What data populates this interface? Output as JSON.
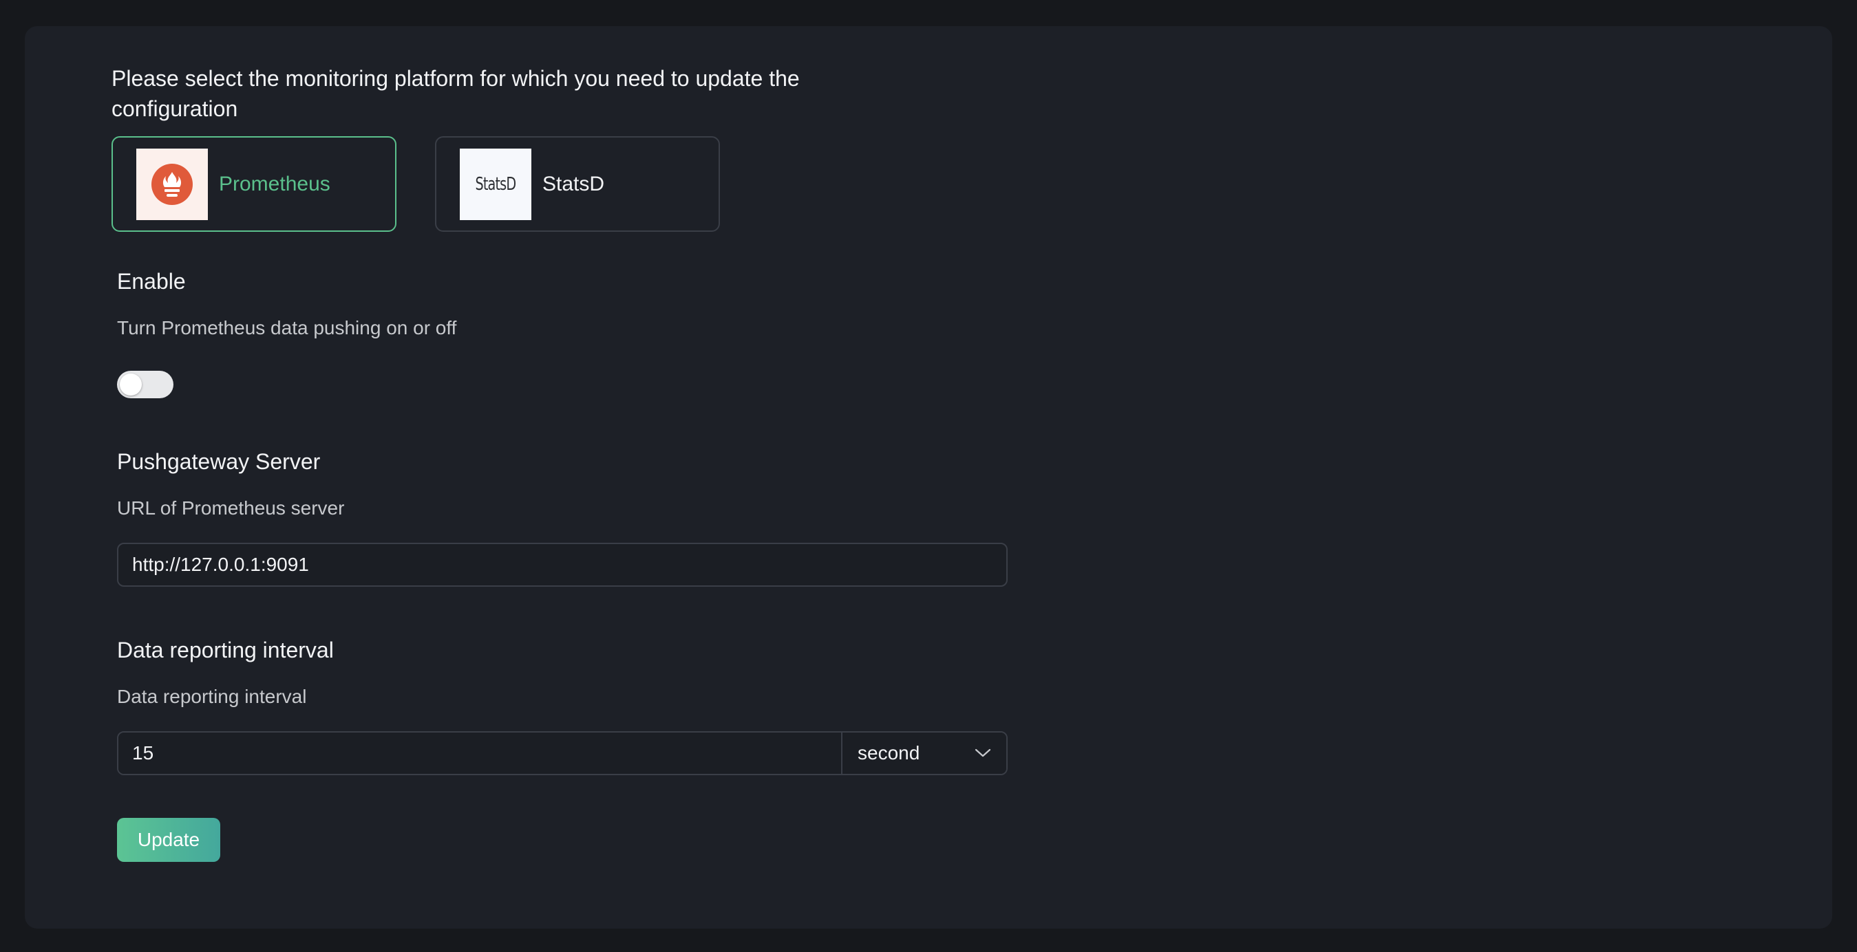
{
  "intro": {
    "text": "Please select the monitoring platform for which you need to update the configuration"
  },
  "platforms": [
    {
      "label": "Prometheus",
      "icon": "prometheus-logo-icon",
      "selected": true,
      "color": "#e05a3a"
    },
    {
      "label": "StatsD",
      "icon": "statsd-logo-icon",
      "selected": false,
      "logo_text": "StatsD"
    }
  ],
  "enable": {
    "title": "Enable",
    "description": "Turn Prometheus data pushing on or off",
    "value": false
  },
  "pushgateway": {
    "title": "Pushgateway Server",
    "description": "URL of Prometheus server",
    "value": "http://127.0.0.1:9091"
  },
  "interval": {
    "title": "Data reporting interval",
    "description": "Data reporting interval",
    "value": "15",
    "unit": "second"
  },
  "actions": {
    "update_label": "Update"
  },
  "colors": {
    "accent": "#5bc08c",
    "background": "#1d2027",
    "border": "#3a3e47"
  }
}
